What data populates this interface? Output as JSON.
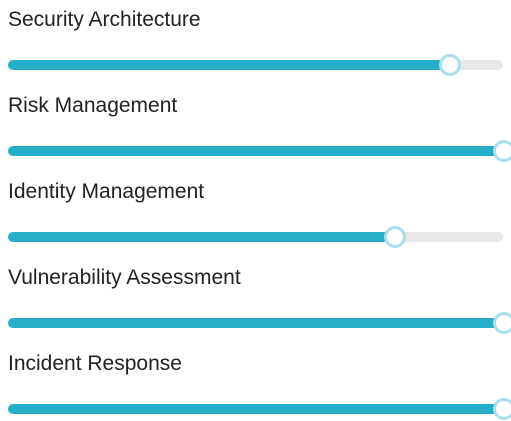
{
  "colors": {
    "fill": "#25afc8",
    "track": "#e8e8e8",
    "thumb_ring": "#a8dff0",
    "label": "#222222"
  },
  "skills": [
    {
      "label": "Security Architecture",
      "value": 0.89
    },
    {
      "label": "Risk Management",
      "value": 1.0
    },
    {
      "label": "Identity Management",
      "value": 0.78
    },
    {
      "label": "Vulnerability Assessment",
      "value": 1.0
    },
    {
      "label": "Incident Response",
      "value": 1.0
    }
  ]
}
